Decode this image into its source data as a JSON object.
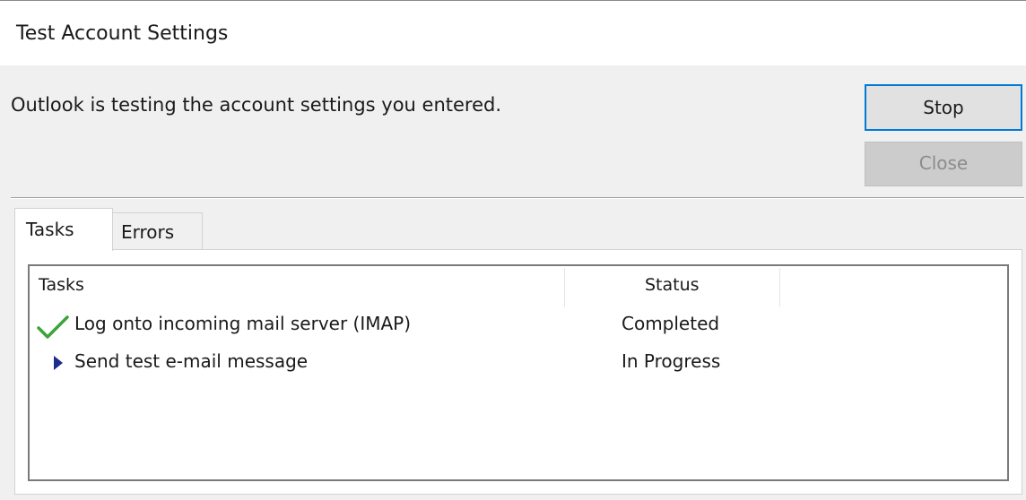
{
  "window": {
    "title": "Test Account Settings"
  },
  "message": "Outlook is testing the account settings you entered.",
  "buttons": {
    "stop_label": "Stop",
    "close_label": "Close"
  },
  "tabs": [
    {
      "label": "Tasks",
      "active": true
    },
    {
      "label": "Errors",
      "active": false
    }
  ],
  "task_list": {
    "columns": [
      "Tasks",
      "Status"
    ],
    "rows": [
      {
        "task": "Log onto incoming mail server (IMAP)",
        "status": "Completed",
        "icon": "checkmark-icon"
      },
      {
        "task": "Send test e-mail message",
        "status": "In Progress",
        "icon": "arrow-right-icon"
      }
    ]
  },
  "colors": {
    "accent_focus": "#0078d7",
    "check_green": "#3aa53a",
    "arrow_navy": "#1c2d8c"
  }
}
